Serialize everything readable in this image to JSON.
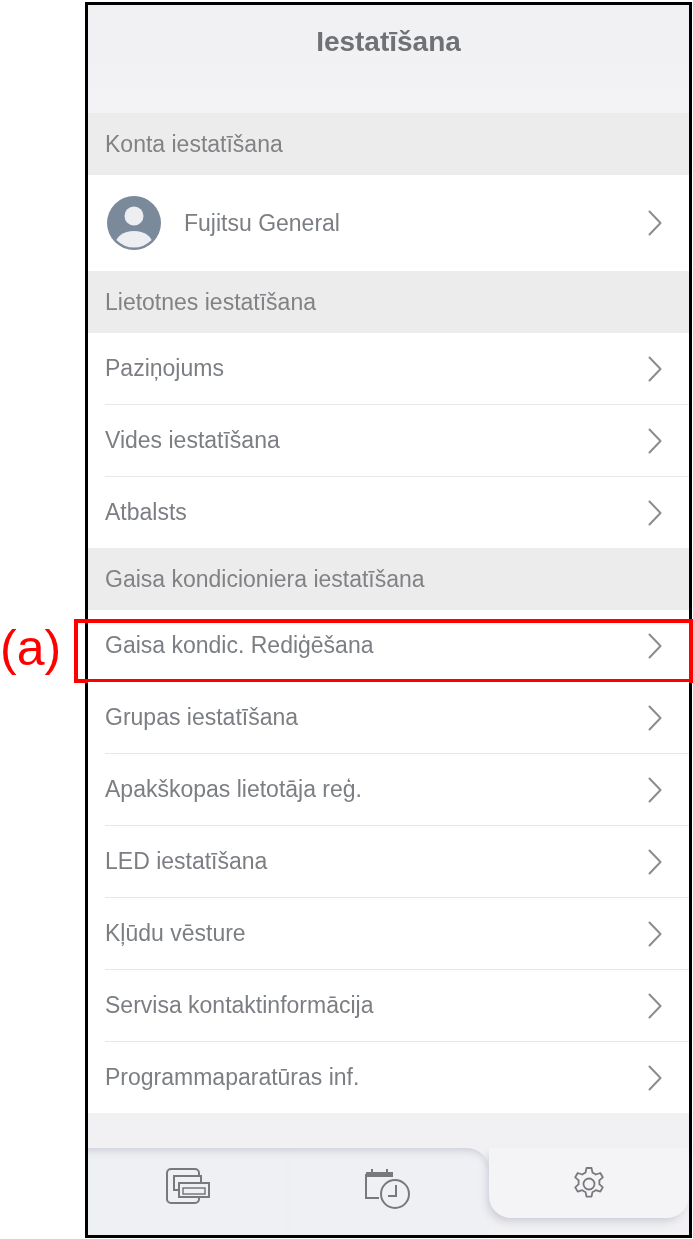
{
  "screen": {
    "title": "Iestatīšana"
  },
  "sections": [
    {
      "heading": "Konta iestatīšana",
      "items": [
        {
          "kind": "account",
          "label": "Fujitsu General",
          "highlighted": false
        }
      ]
    },
    {
      "heading": "Lietotnes iestatīšana",
      "items": [
        {
          "kind": "link",
          "label": "Paziņojums",
          "highlighted": false
        },
        {
          "kind": "link",
          "label": "Vides iestatīšana",
          "highlighted": false
        },
        {
          "kind": "link",
          "label": "Atbalsts",
          "highlighted": false
        }
      ]
    },
    {
      "heading": "Gaisa kondicioniera iestatīšana",
      "items": [
        {
          "kind": "link",
          "label": "Gaisa kondic. Rediģēšana",
          "highlighted": true,
          "callout_label": "(a)"
        },
        {
          "kind": "link",
          "label": "Grupas iestatīšana",
          "highlighted": false
        },
        {
          "kind": "link",
          "label": "Apakškopas lietotāja reģ.",
          "highlighted": false
        },
        {
          "kind": "link",
          "label": "LED iestatīšana",
          "highlighted": false
        },
        {
          "kind": "link",
          "label": "Kļūdu vēsture",
          "highlighted": false
        },
        {
          "kind": "link",
          "label": "Servisa kontaktinformācija",
          "highlighted": false
        },
        {
          "kind": "link",
          "label": "Programmaparatūras inf.",
          "highlighted": false
        }
      ]
    }
  ],
  "tabs": [
    {
      "kind": "units",
      "selected": false
    },
    {
      "kind": "schedule",
      "selected": false
    },
    {
      "kind": "settings",
      "selected": true
    }
  ]
}
